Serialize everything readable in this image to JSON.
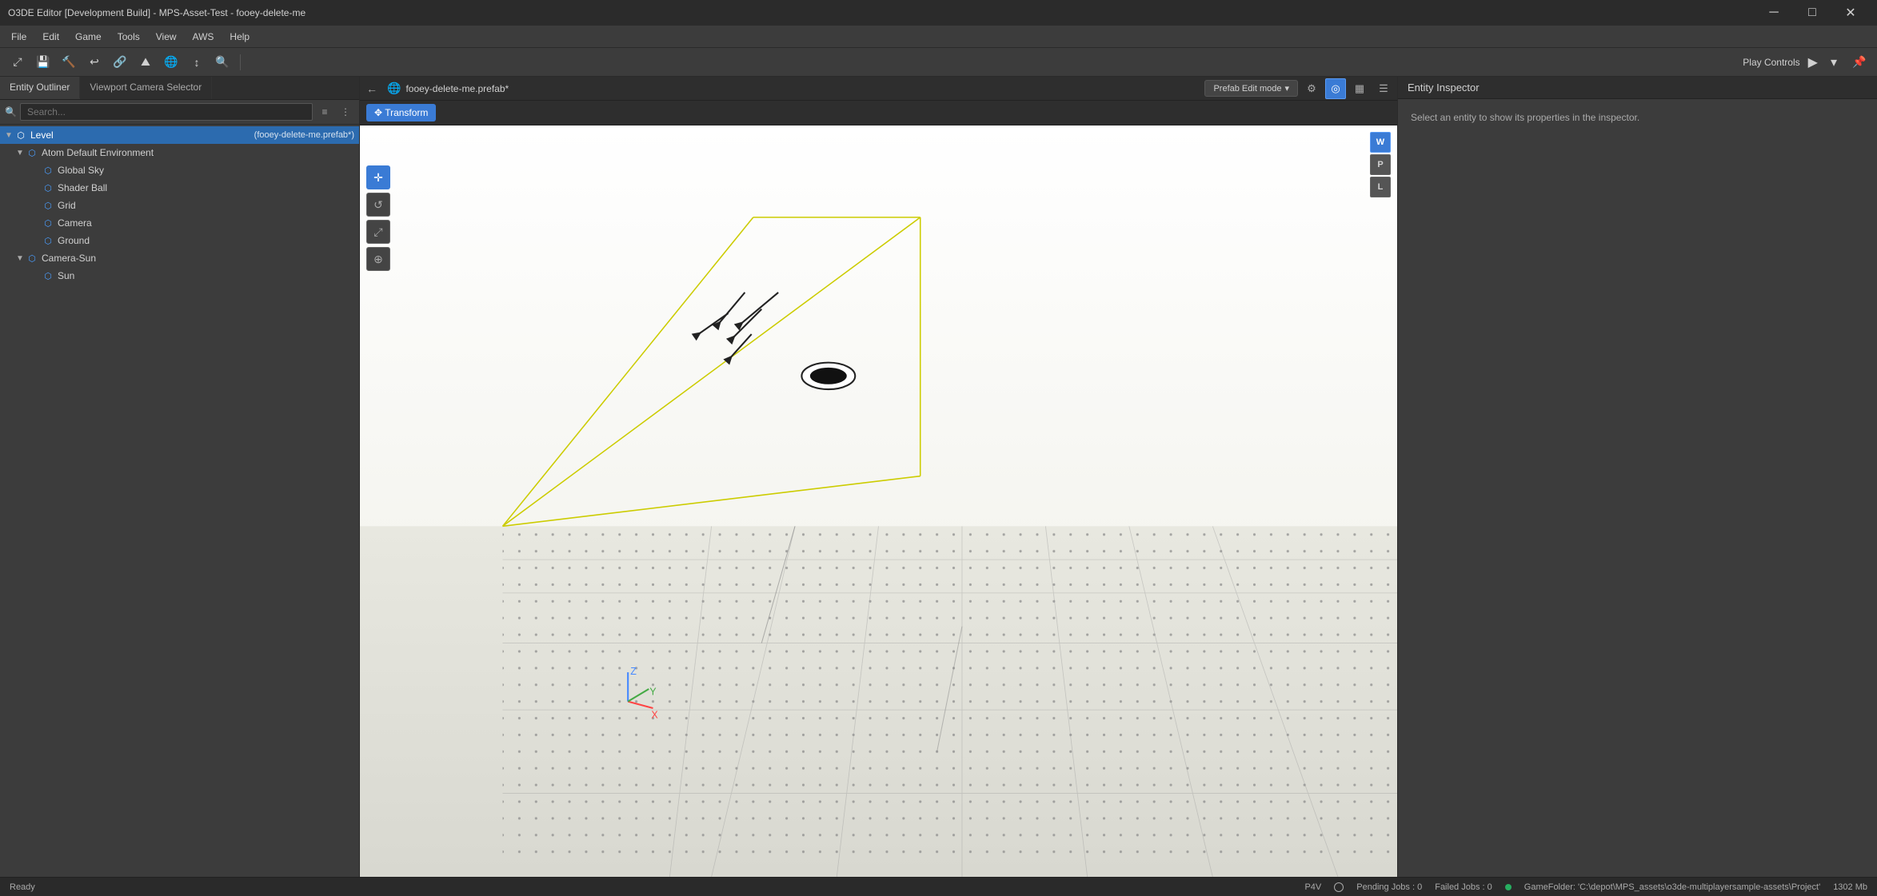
{
  "window": {
    "title": "O3DE Editor [Development Build] - MPS-Asset-Test - fooey-delete-me"
  },
  "titlebar": {
    "minimize": "─",
    "maximize": "□",
    "close": "✕"
  },
  "menubar": {
    "items": [
      "File",
      "Edit",
      "Game",
      "Tools",
      "View",
      "AWS",
      "Help"
    ]
  },
  "toolbar": {
    "play_controls_label": "Play Controls",
    "play_icon": "▶",
    "play_dropdown": "▾",
    "pin_icon": "📌"
  },
  "left_panel": {
    "tabs": [
      "Entity Outliner",
      "Viewport Camera Selector"
    ],
    "active_tab": 0,
    "search_placeholder": "Search...",
    "entities": [
      {
        "id": "level",
        "label": "Level",
        "indent": 0,
        "expanded": true,
        "selected": true,
        "suffix": "(fooey-delete-me.prefab*)",
        "type": "level"
      },
      {
        "id": "atom-default-env",
        "label": "Atom Default Environment",
        "indent": 1,
        "expanded": true,
        "type": "folder"
      },
      {
        "id": "global-sky",
        "label": "Global Sky",
        "indent": 2,
        "type": "cube"
      },
      {
        "id": "shader-ball",
        "label": "Shader Ball",
        "indent": 2,
        "type": "cube"
      },
      {
        "id": "grid",
        "label": "Grid",
        "indent": 2,
        "type": "cube"
      },
      {
        "id": "camera",
        "label": "Camera",
        "indent": 2,
        "type": "cube",
        "has_camera_icon": true
      },
      {
        "id": "ground",
        "label": "Ground",
        "indent": 2,
        "type": "cube"
      },
      {
        "id": "camera-sun",
        "label": "Camera-Sun",
        "indent": 1,
        "expanded": true,
        "type": "folder"
      },
      {
        "id": "sun",
        "label": "Sun",
        "indent": 2,
        "type": "cube"
      }
    ]
  },
  "viewport": {
    "back_button": "←",
    "globe_icon": "🌐",
    "prefab_name": "fooey-delete-me.prefab*",
    "mode_label": "Prefab Edit mode",
    "mode_dropdown": "▾",
    "wpl_buttons": [
      "W",
      "P",
      "L"
    ],
    "active_wpl": "W",
    "transform_label": "Transform",
    "viewport_tools": [
      "+",
      "↺",
      "⤢"
    ],
    "scene_bg": "#f5f5f0"
  },
  "inspector": {
    "title": "Entity Inspector",
    "empty_message": "Select an entity to show its properties in the inspector."
  },
  "status_bar": {
    "ready": "Ready",
    "p4v": "P4V",
    "pending_jobs": "Pending Jobs : 0",
    "failed_jobs": "Failed Jobs : 0",
    "game_folder_label": "GameFolder: 'C:\\depot\\MPS_assets\\o3de-multiplayersample-assets\\Project'",
    "memory": "1302 Mb"
  }
}
